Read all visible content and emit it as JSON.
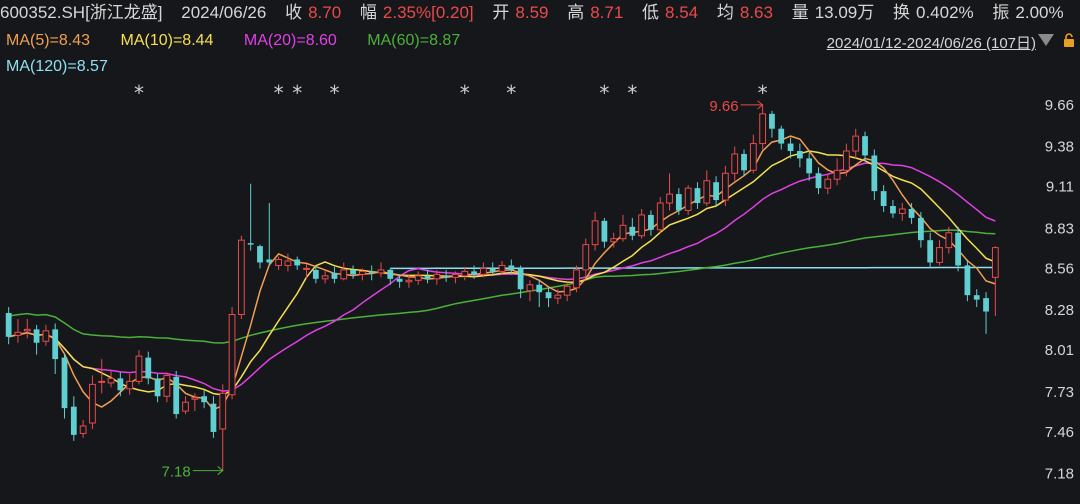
{
  "header": {
    "code": "600352.SH[浙江龙盛]",
    "date": "2024/06/26",
    "close_label": "收",
    "close": "8.70",
    "change_label": "幅",
    "change": "2.35%[0.20]",
    "open_label": "开",
    "open": "8.59",
    "high_label": "高",
    "high": "8.71",
    "low_label": "低",
    "low": "8.54",
    "avg_label": "均",
    "avg": "8.63",
    "volume_label": "量",
    "volume": "13.09万",
    "turnover_label": "换",
    "turnover": "0.402%",
    "amplitude_label": "振",
    "amplitude": "2.00%"
  },
  "ma_legend": {
    "ma5": "MA(5)=8.43",
    "ma10": "MA(10)=8.44",
    "ma20": "MA(20)=8.60",
    "ma60": "MA(60)=8.87",
    "ma120": "MA(120)=8.57"
  },
  "range_label": "2024/01/12-2024/06/26 (107日)",
  "colors": {
    "up": "#e84a4a",
    "down": "#5fcfd2",
    "ma5": "#f0a050",
    "ma10": "#f5e04e",
    "ma20": "#e040e6",
    "ma60": "#4cb03a",
    "ma120": "#8ee0f0",
    "axis_text": "#d6d6d6",
    "lock": "#e8a020"
  },
  "chart_data": {
    "type": "candlestick",
    "yticks": [
      9.66,
      9.38,
      9.11,
      8.83,
      8.56,
      8.28,
      8.01,
      7.73,
      7.46,
      7.18
    ],
    "ylim": [
      7.15,
      9.72
    ],
    "annotations": {
      "high_label": "9.66",
      "low_label": "7.18"
    },
    "star_marker": "*",
    "star_indices": [
      14,
      29,
      31,
      35,
      49,
      54,
      64,
      67,
      81
    ],
    "candles": [
      [
        8.26,
        8.1,
        8.3,
        8.05
      ],
      [
        8.11,
        8.13,
        8.22,
        8.06
      ],
      [
        8.14,
        8.15,
        8.22,
        8.09
      ],
      [
        8.15,
        8.06,
        8.18,
        7.98
      ],
      [
        8.07,
        8.14,
        8.18,
        8.04
      ],
      [
        8.15,
        7.95,
        8.19,
        7.85
      ],
      [
        7.96,
        7.62,
        7.99,
        7.55
      ],
      [
        7.63,
        7.44,
        7.7,
        7.4
      ],
      [
        7.45,
        7.5,
        7.54,
        7.42
      ],
      [
        7.52,
        7.78,
        7.84,
        7.48
      ],
      [
        7.8,
        7.8,
        7.95,
        7.72
      ],
      [
        7.79,
        7.82,
        7.87,
        7.76
      ],
      [
        7.82,
        7.74,
        7.86,
        7.7
      ],
      [
        7.75,
        7.8,
        7.85,
        7.71
      ],
      [
        7.8,
        7.97,
        8.01,
        7.78
      ],
      [
        7.96,
        7.82,
        8.0,
        7.78
      ],
      [
        7.82,
        7.7,
        7.85,
        7.66
      ],
      [
        7.7,
        7.84,
        7.86,
        7.66
      ],
      [
        7.83,
        7.58,
        7.87,
        7.55
      ],
      [
        7.6,
        7.66,
        7.7,
        7.58
      ],
      [
        7.68,
        7.69,
        7.72,
        7.6
      ],
      [
        7.7,
        7.66,
        7.74,
        7.62
      ],
      [
        7.65,
        7.46,
        7.7,
        7.42
      ],
      [
        7.48,
        7.72,
        7.78,
        7.2
      ],
      [
        7.71,
        8.25,
        8.3,
        7.68
      ],
      [
        8.25,
        8.75,
        8.78,
        8.22
      ],
      [
        8.73,
        8.72,
        9.13,
        8.68
      ],
      [
        8.71,
        8.6,
        8.72,
        8.56
      ],
      [
        8.62,
        8.6,
        9.0,
        8.58
      ],
      [
        8.58,
        8.62,
        8.64,
        8.55
      ],
      [
        8.58,
        8.61,
        8.66,
        8.54
      ],
      [
        8.62,
        8.58,
        8.64,
        8.55
      ],
      [
        8.56,
        8.56,
        8.59,
        8.49
      ],
      [
        8.55,
        8.49,
        8.58,
        8.46
      ],
      [
        8.49,
        8.51,
        8.55,
        8.46
      ],
      [
        8.53,
        8.49,
        8.57,
        8.46
      ],
      [
        8.49,
        8.55,
        8.6,
        8.48
      ],
      [
        8.55,
        8.52,
        8.58,
        8.49
      ],
      [
        8.52,
        8.54,
        8.56,
        8.48
      ],
      [
        8.54,
        8.53,
        8.58,
        8.48
      ],
      [
        8.53,
        8.55,
        8.6,
        8.5
      ],
      [
        8.55,
        8.49,
        8.56,
        8.45
      ],
      [
        8.49,
        8.47,
        8.52,
        8.43
      ],
      [
        8.47,
        8.48,
        8.52,
        8.43
      ],
      [
        8.48,
        8.51,
        8.54,
        8.45
      ],
      [
        8.51,
        8.49,
        8.55,
        8.46
      ],
      [
        8.49,
        8.52,
        8.55,
        8.45
      ],
      [
        8.51,
        8.5,
        8.55,
        8.47
      ],
      [
        8.5,
        8.52,
        8.54,
        8.46
      ],
      [
        8.51,
        8.54,
        8.57,
        8.48
      ],
      [
        8.54,
        8.52,
        8.58,
        8.49
      ],
      [
        8.52,
        8.56,
        8.6,
        8.5
      ],
      [
        8.56,
        8.54,
        8.6,
        8.51
      ],
      [
        8.54,
        8.58,
        8.61,
        8.52
      ],
      [
        8.58,
        8.55,
        8.62,
        8.52
      ],
      [
        8.56,
        8.42,
        8.58,
        8.36
      ],
      [
        8.41,
        8.45,
        8.48,
        8.34
      ],
      [
        8.45,
        8.4,
        8.48,
        8.3
      ],
      [
        8.4,
        8.36,
        8.43,
        8.3
      ],
      [
        8.36,
        8.38,
        8.42,
        8.32
      ],
      [
        8.38,
        8.44,
        8.46,
        8.34
      ],
      [
        8.43,
        8.55,
        8.58,
        8.4
      ],
      [
        8.55,
        8.72,
        8.76,
        8.5
      ],
      [
        8.72,
        8.88,
        8.94,
        8.68
      ],
      [
        8.88,
        8.74,
        8.9,
        8.7
      ],
      [
        8.74,
        8.76,
        8.8,
        8.7
      ],
      [
        8.76,
        8.85,
        8.92,
        8.74
      ],
      [
        8.84,
        8.78,
        8.9,
        8.75
      ],
      [
        8.78,
        8.92,
        8.96,
        8.76
      ],
      [
        8.92,
        8.82,
        8.95,
        8.78
      ],
      [
        8.82,
        9.0,
        9.04,
        8.8
      ],
      [
        9.0,
        9.06,
        9.2,
        8.95
      ],
      [
        9.06,
        8.95,
        9.1,
        8.92
      ],
      [
        8.95,
        9.1,
        9.12,
        8.92
      ],
      [
        9.1,
        9.0,
        9.14,
        8.96
      ],
      [
        9.0,
        9.15,
        9.22,
        8.98
      ],
      [
        9.14,
        9.02,
        9.18,
        8.98
      ],
      [
        9.02,
        9.2,
        9.25,
        8.98
      ],
      [
        9.2,
        9.33,
        9.38,
        9.15
      ],
      [
        9.33,
        9.22,
        9.36,
        9.18
      ],
      [
        9.22,
        9.4,
        9.46,
        9.2
      ],
      [
        9.4,
        9.6,
        9.66,
        9.36
      ],
      [
        9.6,
        9.5,
        9.62,
        9.44
      ],
      [
        9.5,
        9.4,
        9.52,
        9.36
      ],
      [
        9.4,
        9.35,
        9.44,
        9.3
      ],
      [
        9.35,
        9.3,
        9.4,
        9.24
      ],
      [
        9.3,
        9.2,
        9.34,
        9.15
      ],
      [
        9.2,
        9.1,
        9.24,
        9.06
      ],
      [
        9.1,
        9.16,
        9.2,
        9.06
      ],
      [
        9.16,
        9.22,
        9.3,
        9.12
      ],
      [
        9.22,
        9.35,
        9.4,
        9.18
      ],
      [
        9.35,
        9.45,
        9.5,
        9.3
      ],
      [
        9.45,
        9.32,
        9.48,
        9.28
      ],
      [
        9.32,
        9.08,
        9.36,
        9.02
      ],
      [
        9.08,
        8.98,
        9.12,
        8.94
      ],
      [
        8.98,
        8.93,
        9.02,
        8.9
      ],
      [
        8.93,
        8.96,
        9.0,
        8.88
      ],
      [
        8.96,
        8.9,
        9.0,
        8.86
      ],
      [
        8.9,
        8.75,
        8.94,
        8.7
      ],
      [
        8.75,
        8.6,
        8.8,
        8.56
      ],
      [
        8.6,
        8.7,
        8.75,
        8.58
      ],
      [
        8.7,
        8.8,
        8.84,
        8.66
      ],
      [
        8.8,
        8.58,
        8.84,
        8.54
      ],
      [
        8.58,
        8.38,
        8.62,
        8.34
      ],
      [
        8.38,
        8.35,
        8.42,
        8.3
      ],
      [
        8.36,
        8.27,
        8.4,
        8.12
      ],
      [
        8.5,
        8.7,
        8.71,
        8.24
      ]
    ]
  }
}
